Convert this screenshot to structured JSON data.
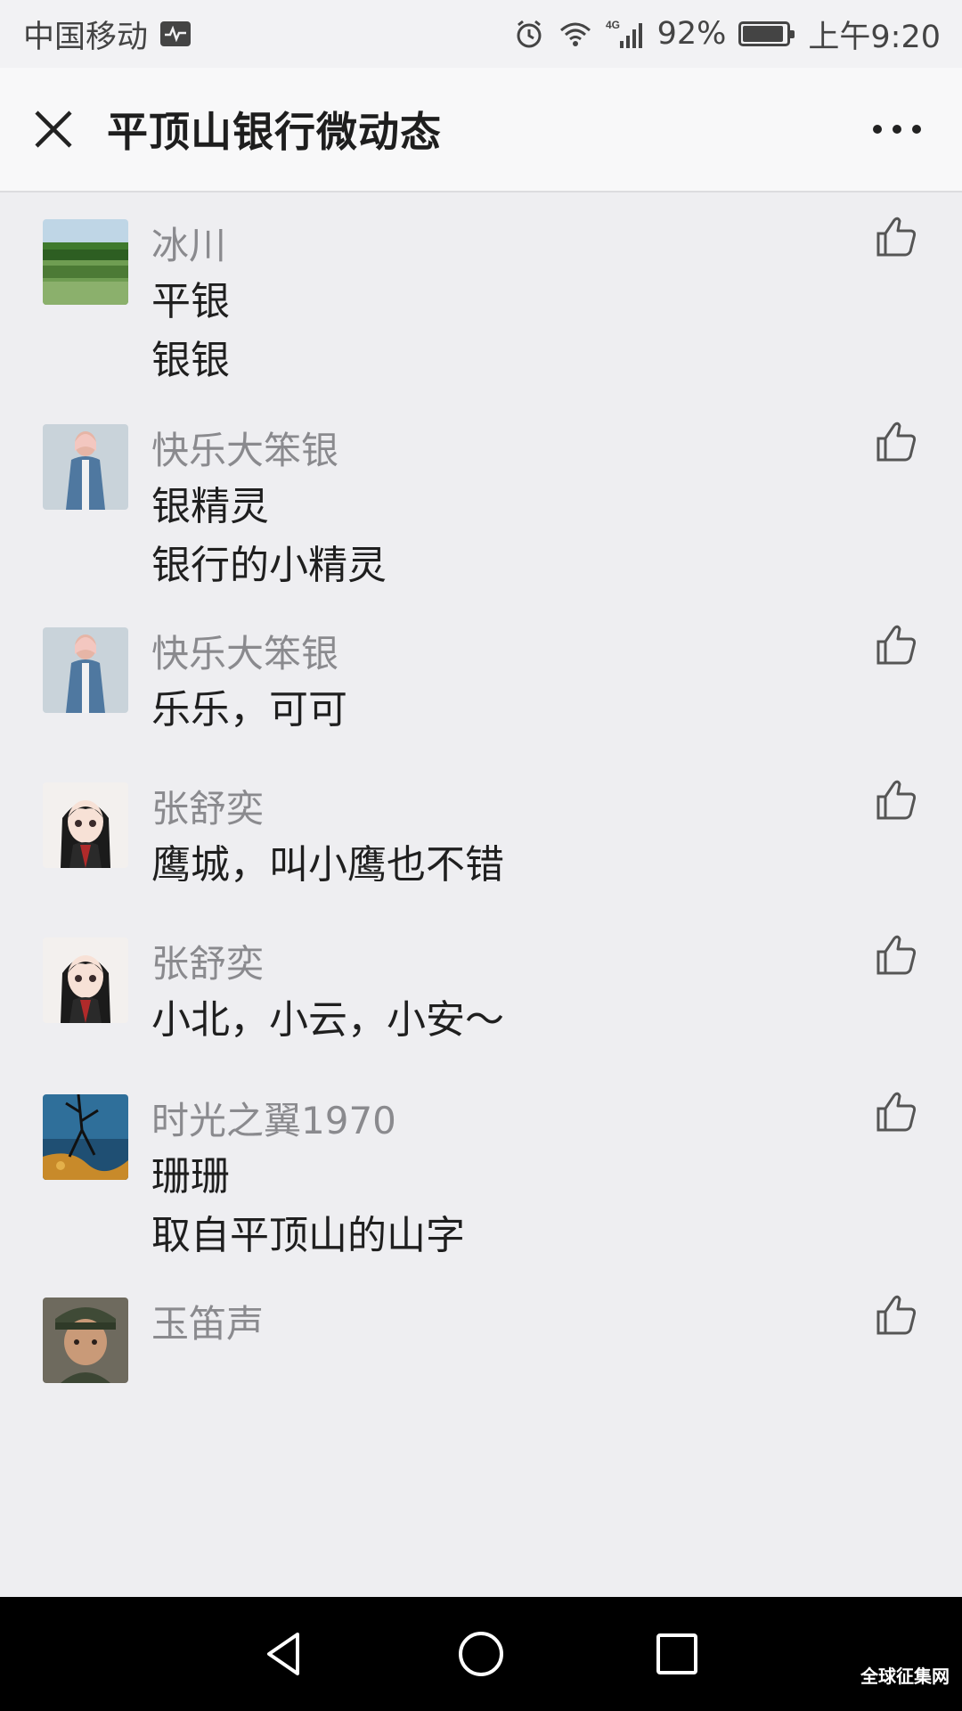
{
  "status_bar": {
    "carrier": "中国移动",
    "network": "4G",
    "battery": "92%",
    "battery_level": 0.92,
    "time": "上午9:20",
    "icons": [
      "activity-icon",
      "alarm-icon",
      "wifi-icon",
      "signal-icon",
      "battery-icon"
    ]
  },
  "header": {
    "title": "平顶山银行微动态",
    "close_icon": "close-icon",
    "more_icon": "more-icon"
  },
  "comments": [
    {
      "nickname": "冰川",
      "lines": [
        "平银",
        "银银"
      ],
      "avatar": "lake-landscape"
    },
    {
      "nickname": "快乐大笨银",
      "lines": [
        "银精灵",
        "银行的小精灵"
      ],
      "avatar": "girl-denim-coat"
    },
    {
      "nickname": "快乐大笨银",
      "lines": [
        "乐乐，可可"
      ],
      "avatar": "girl-denim-coat"
    },
    {
      "nickname": "张舒奕",
      "lines": [
        "鹰城，叫小鹰也不错"
      ],
      "avatar": "cartoon-girl"
    },
    {
      "nickname": "张舒奕",
      "lines": [
        "小北，小云，小安～"
      ],
      "avatar": "cartoon-girl"
    },
    {
      "nickname": "时光之翼1970",
      "lines": [
        "珊珊",
        "取自平顶山的山字"
      ],
      "avatar": "tree-reflection"
    },
    {
      "nickname": "玉笛声",
      "lines": [],
      "avatar": "man-in-cap"
    }
  ],
  "nav_bar": {
    "buttons": [
      "back-icon",
      "home-icon",
      "recents-icon"
    ]
  },
  "watermark": "全球征集网",
  "colors": {
    "background": "#eeeef1",
    "header_bg": "#f8f8f9",
    "nickname": "#8a8a8e",
    "text": "#1f1f1f",
    "like_icon": "#555555",
    "nav_bar": "#000000"
  }
}
